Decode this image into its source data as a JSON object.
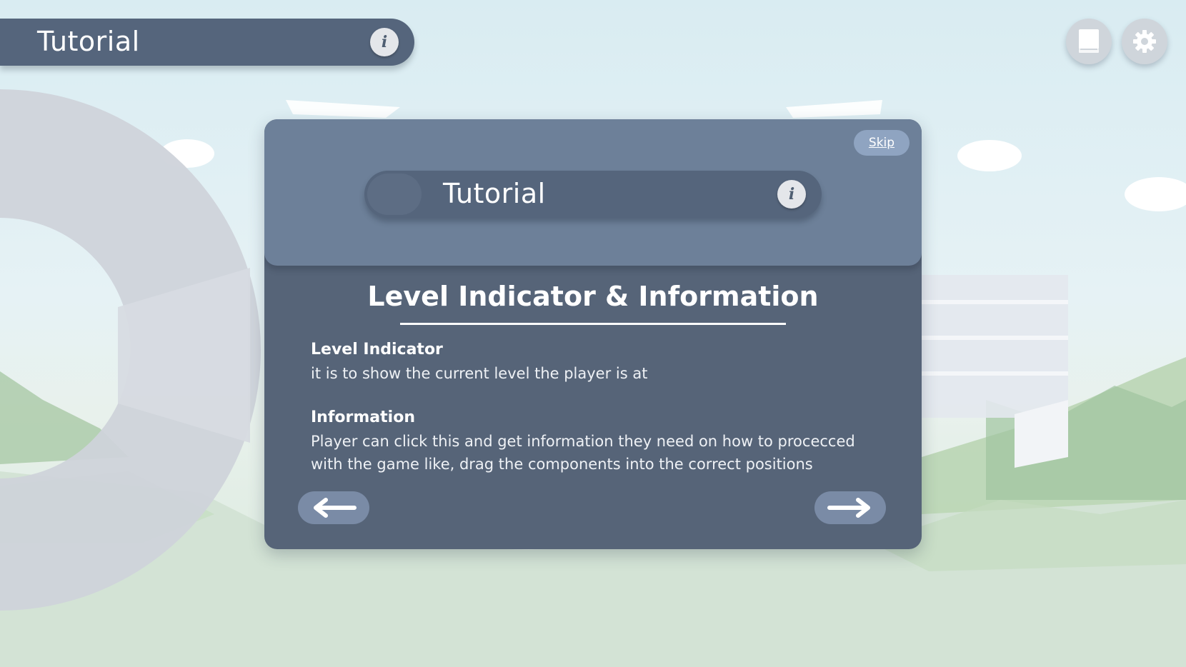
{
  "hud": {
    "level_title": "Tutorial",
    "info_icon": "i",
    "book_icon": "book-icon",
    "settings_icon": "gear-icon"
  },
  "dialog": {
    "skip_label": "Skip",
    "preview_title": "Tutorial",
    "preview_info_icon": "i",
    "heading": "Level Indicator & Information",
    "sections": [
      {
        "title": "Level Indicator",
        "body": "it is to show the current level the player is at"
      },
      {
        "title": "Information",
        "body": "Player can click this and get information they need on how to procecced with the game like, drag the components into the correct positions"
      }
    ],
    "prev_icon": "arrow-left-icon",
    "next_icon": "arrow-right-icon"
  },
  "colors": {
    "panel_dark": "#566478",
    "panel_light": "#6d8099",
    "bar": "#55657c",
    "button": "#7a8ba6",
    "skip": "#8fa4c1"
  }
}
